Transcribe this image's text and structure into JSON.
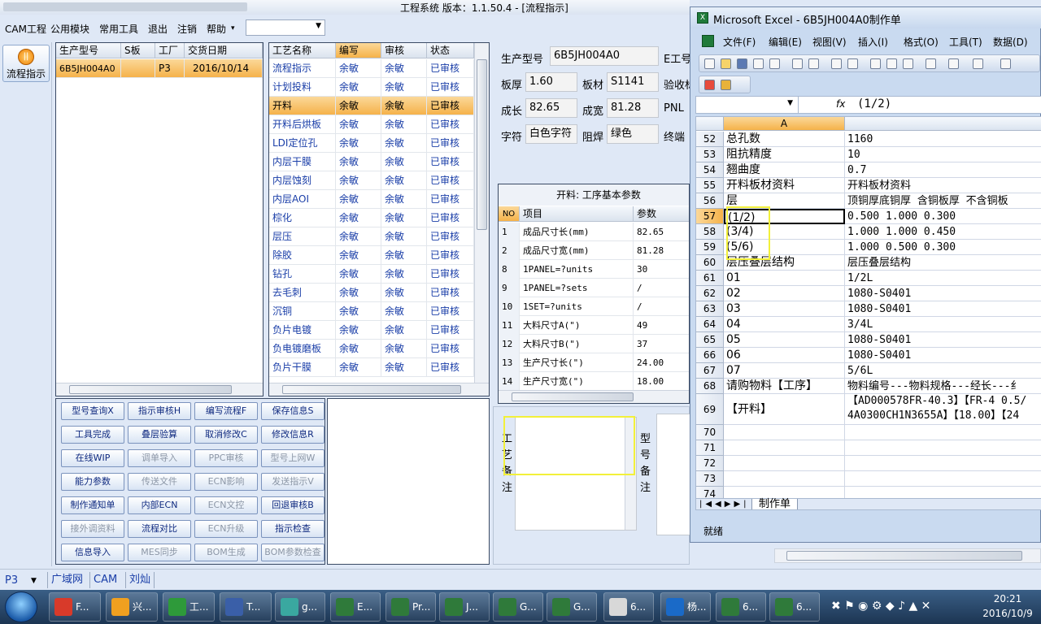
{
  "app": {
    "title": "工程系统 版本：1.1.50.4 - [流程指示]",
    "menu": [
      "CAM工程",
      "公用模块",
      "常用工具",
      "退出",
      "注销",
      "帮助"
    ],
    "help_arrow": "▾",
    "combo_value": "",
    "nav_button": "流程指示"
  },
  "models_table": {
    "headers": [
      "生产型号",
      "S板",
      "工厂",
      "交货日期"
    ],
    "rows": [
      [
        "6B5JH004A0",
        "",
        "P3",
        "2016/10/14"
      ]
    ]
  },
  "process_table": {
    "headers": [
      "工艺名称",
      "编写",
      "审核",
      "状态"
    ],
    "selected_index": 2,
    "rows": [
      [
        "流程指示",
        "余敏",
        "余敏",
        "已审核"
      ],
      [
        "计划投料",
        "余敏",
        "余敏",
        "已审核"
      ],
      [
        "开料",
        "余敏",
        "余敏",
        "已审核"
      ],
      [
        "开料后烘板",
        "余敏",
        "余敏",
        "已审核"
      ],
      [
        "LDI定位孔",
        "余敏",
        "余敏",
        "已审核"
      ],
      [
        "内层干膜",
        "余敏",
        "余敏",
        "已审核"
      ],
      [
        "内层蚀刻",
        "余敏",
        "余敏",
        "已审核"
      ],
      [
        "内层AOI",
        "余敏",
        "余敏",
        "已审核"
      ],
      [
        "棕化",
        "余敏",
        "余敏",
        "已审核"
      ],
      [
        "层压",
        "余敏",
        "余敏",
        "已审核"
      ],
      [
        "除胶",
        "余敏",
        "余敏",
        "已审核"
      ],
      [
        "钻孔",
        "余敏",
        "余敏",
        "已审核"
      ],
      [
        "去毛刺",
        "余敏",
        "余敏",
        "已审核"
      ],
      [
        "沉铜",
        "余敏",
        "余敏",
        "已审核"
      ],
      [
        "负片电镀",
        "余敏",
        "余敏",
        "已审核"
      ],
      [
        "负电镀磨板",
        "余敏",
        "余敏",
        "已审核"
      ],
      [
        "负片干膜",
        "余敏",
        "余敏",
        "已审核"
      ]
    ]
  },
  "buttons": [
    {
      "label": "型号查询X",
      "enabled": true
    },
    {
      "label": "指示审核H",
      "enabled": true
    },
    {
      "label": "编写流程F",
      "enabled": true
    },
    {
      "label": "保存信息S",
      "enabled": true
    },
    {
      "label": "工具完成",
      "enabled": true
    },
    {
      "label": "叠层验算",
      "enabled": true
    },
    {
      "label": "取消修改C",
      "enabled": true
    },
    {
      "label": "修改信息R",
      "enabled": true
    },
    {
      "label": "在线WIP",
      "enabled": true
    },
    {
      "label": "调单导入",
      "enabled": false
    },
    {
      "label": "PPC审核",
      "enabled": false
    },
    {
      "label": "型号上网W",
      "enabled": false
    },
    {
      "label": "能力参数",
      "enabled": true
    },
    {
      "label": "传送文件",
      "enabled": false
    },
    {
      "label": "ECN影响",
      "enabled": false
    },
    {
      "label": "发送指示V",
      "enabled": false
    },
    {
      "label": "制作通知单",
      "enabled": true
    },
    {
      "label": "内部ECN",
      "enabled": true
    },
    {
      "label": "ECN文控",
      "enabled": false
    },
    {
      "label": "回退审核B",
      "enabled": true
    },
    {
      "label": "接外调资料",
      "enabled": false
    },
    {
      "label": "流程对比",
      "enabled": true
    },
    {
      "label": "ECN升级",
      "enabled": false
    },
    {
      "label": "指示检查",
      "enabled": true
    },
    {
      "label": "信息导入",
      "enabled": true
    },
    {
      "label": "MES同步",
      "enabled": false
    },
    {
      "label": "BOM生成",
      "enabled": false
    },
    {
      "label": "BOM参数检查",
      "enabled": false
    }
  ],
  "info": {
    "model_label": "生产型号",
    "model_value": "6B5JH004A0",
    "e_label": "E工号",
    "thick_label": "板厚",
    "thick_value": "1.60",
    "material_label": "板材",
    "material_value": "S1141",
    "verify_label": "验收标",
    "length_label": "成长",
    "length_value": "82.65",
    "width_label": "成宽",
    "width_value": "81.28",
    "pnl_label": "PNL",
    "char_label": "字符",
    "char_value": "白色字符",
    "mask_label": "阻焊",
    "mask_value": "绿色",
    "terminal_label": "终端"
  },
  "params": {
    "title": "开料: 工序基本参数",
    "headers": [
      "NO",
      "项目",
      "参数"
    ],
    "rows": [
      [
        "1",
        "成品尺寸长(mm)",
        "82.65"
      ],
      [
        "2",
        "成品尺寸宽(mm)",
        "81.28"
      ],
      [
        "8",
        "1PANEL=?units",
        "30"
      ],
      [
        "9",
        "1PANEL=?sets",
        "/"
      ],
      [
        "10",
        "1SET=?units",
        "/"
      ],
      [
        "11",
        "大料尺寸A(\")",
        "49"
      ],
      [
        "12",
        "大料尺寸B(\")",
        "37"
      ],
      [
        "13",
        "生产尺寸长(\")",
        "24.00"
      ],
      [
        "14",
        "生产尺寸宽(\")",
        "18.00"
      ]
    ]
  },
  "remarks": {
    "process_label": "工艺备注",
    "model_label": "型号备注"
  },
  "status": {
    "factory": "P3",
    "items": [
      "广域网",
      "CAM",
      "刘灿"
    ]
  },
  "excel": {
    "title": "Microsoft Excel - 6B5JH004A0制作单",
    "menu": [
      "文件(F)",
      "编辑(E)",
      "视图(V)",
      "插入(I)",
      "格式(O)",
      "工具(T)",
      "数据(D)"
    ],
    "formula": "(1/2)",
    "fx": "fx",
    "col_a": "A",
    "sheet_tab": "制作单",
    "status": "就绪",
    "rows": [
      {
        "n": "52",
        "a": "总孔数",
        "b": "1160"
      },
      {
        "n": "53",
        "a": "阻抗精度",
        "b": "10"
      },
      {
        "n": "54",
        "a": "翘曲度",
        "b": "0.7"
      },
      {
        "n": "55",
        "a": "开料板材资料",
        "b": "开料板材资料"
      },
      {
        "n": "56",
        "a": "层",
        "b": "顶铜厚底铜厚 含铜板厚 不含铜板"
      },
      {
        "n": "57",
        "a": "(1/2)",
        "b": "0.500  1.000     0.300"
      },
      {
        "n": "58",
        "a": "(3/4)",
        "b": "1.000  1.000     0.450"
      },
      {
        "n": "59",
        "a": "(5/6)",
        "b": "1.000  0.500     0.300"
      },
      {
        "n": "60",
        "a": "层压叠层结构",
        "b": "层压叠层结构"
      },
      {
        "n": "61",
        "a": "01",
        "b": "1/2L"
      },
      {
        "n": "62",
        "a": "02",
        "b": "1080-S0401"
      },
      {
        "n": "63",
        "a": "03",
        "b": "1080-S0401"
      },
      {
        "n": "64",
        "a": "04",
        "b": "3/4L"
      },
      {
        "n": "65",
        "a": "05",
        "b": "1080-S0401"
      },
      {
        "n": "66",
        "a": "06",
        "b": "1080-S0401"
      },
      {
        "n": "67",
        "a": "07",
        "b": "5/6L"
      },
      {
        "n": "68",
        "a": "请购物料【工序】",
        "b": "物料编号---物料规格---经长---纟"
      },
      {
        "n": "69",
        "a": "【开料】",
        "b": "【AD000578FR-40.3】【FR-4 0.5/"
      },
      {
        "n": "70",
        "a": "",
        "b": ""
      },
      {
        "n": "71",
        "a": "",
        "b": ""
      },
      {
        "n": "72",
        "a": "",
        "b": ""
      },
      {
        "n": "73",
        "a": "",
        "b": ""
      },
      {
        "n": "74",
        "a": "",
        "b": ""
      }
    ],
    "row69_line2": "4A0300CH1N3655A】【18.00】【24"
  },
  "taskbar": {
    "items": [
      "F...",
      "兴...",
      "工...",
      "T...",
      "g...",
      "E...",
      "Pr...",
      "J...",
      "G...",
      "G...",
      "6...",
      "杨...",
      "6...",
      "6..."
    ],
    "time": "20:21",
    "date": "2016/10/9"
  },
  "colors": {
    "accent": "#f5b24a",
    "link": "#1a3ea8",
    "highlight": "#f2f03a"
  }
}
